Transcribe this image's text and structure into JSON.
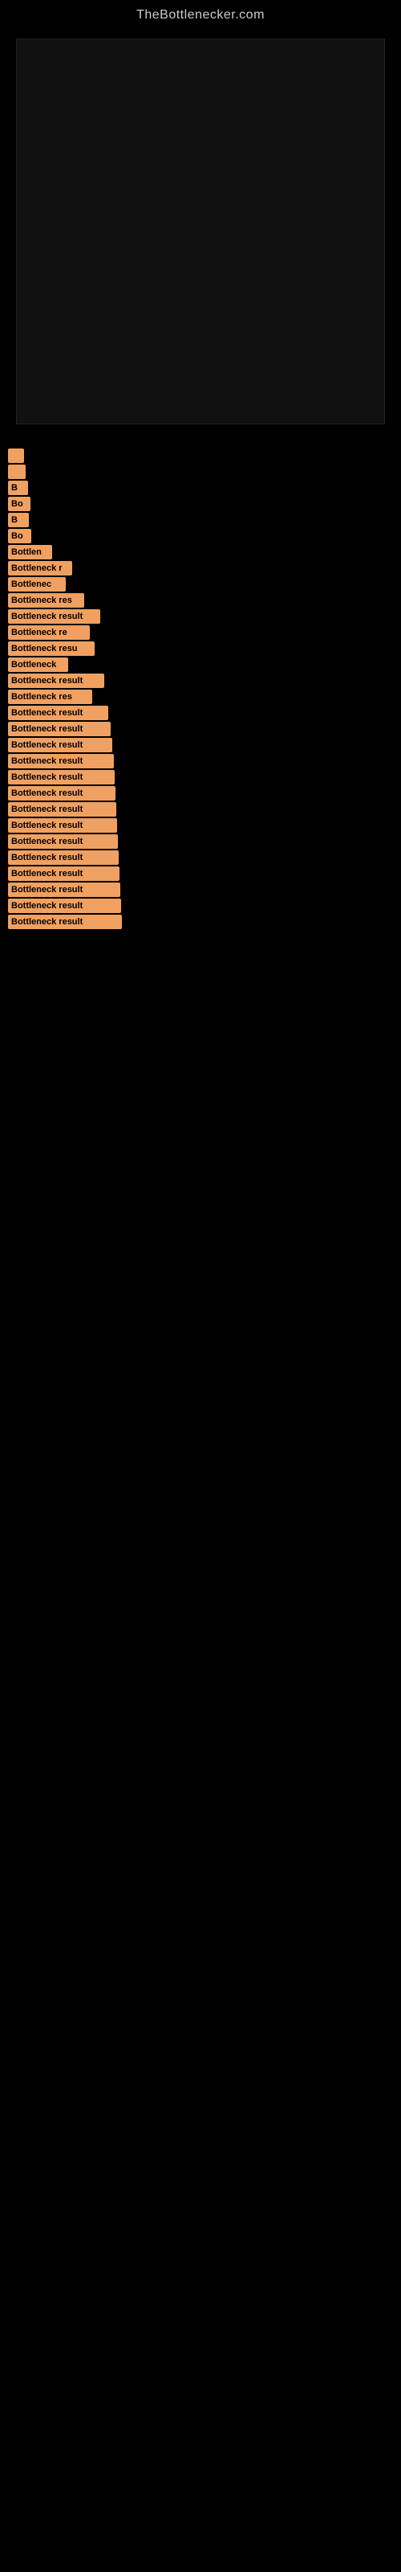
{
  "site": {
    "title": "TheBottlenecker.com"
  },
  "bars": [
    {
      "width": 20,
      "label": ""
    },
    {
      "width": 22,
      "label": ""
    },
    {
      "width": 25,
      "label": "B"
    },
    {
      "width": 28,
      "label": "Bo"
    },
    {
      "width": 26,
      "label": "B"
    },
    {
      "width": 29,
      "label": "Bo"
    },
    {
      "width": 55,
      "label": "Bottlen"
    },
    {
      "width": 80,
      "label": "Bottleneck r"
    },
    {
      "width": 72,
      "label": "Bottlenec"
    },
    {
      "width": 95,
      "label": "Bottleneck res"
    },
    {
      "width": 115,
      "label": "Bottleneck result"
    },
    {
      "width": 102,
      "label": "Bottleneck re"
    },
    {
      "width": 108,
      "label": "Bottleneck resu"
    },
    {
      "width": 75,
      "label": "Bottleneck"
    },
    {
      "width": 120,
      "label": "Bottleneck result"
    },
    {
      "width": 105,
      "label": "Bottleneck res"
    },
    {
      "width": 125,
      "label": "Bottleneck result"
    },
    {
      "width": 128,
      "label": "Bottleneck result"
    },
    {
      "width": 130,
      "label": "Bottleneck result"
    },
    {
      "width": 132,
      "label": "Bottleneck result"
    },
    {
      "width": 133,
      "label": "Bottleneck result"
    },
    {
      "width": 134,
      "label": "Bottleneck result"
    },
    {
      "width": 135,
      "label": "Bottleneck result"
    },
    {
      "width": 136,
      "label": "Bottleneck result"
    },
    {
      "width": 137,
      "label": "Bottleneck result"
    },
    {
      "width": 138,
      "label": "Bottleneck result"
    },
    {
      "width": 139,
      "label": "Bottleneck result"
    },
    {
      "width": 140,
      "label": "Bottleneck result"
    },
    {
      "width": 141,
      "label": "Bottleneck result"
    },
    {
      "width": 142,
      "label": "Bottleneck result"
    }
  ]
}
